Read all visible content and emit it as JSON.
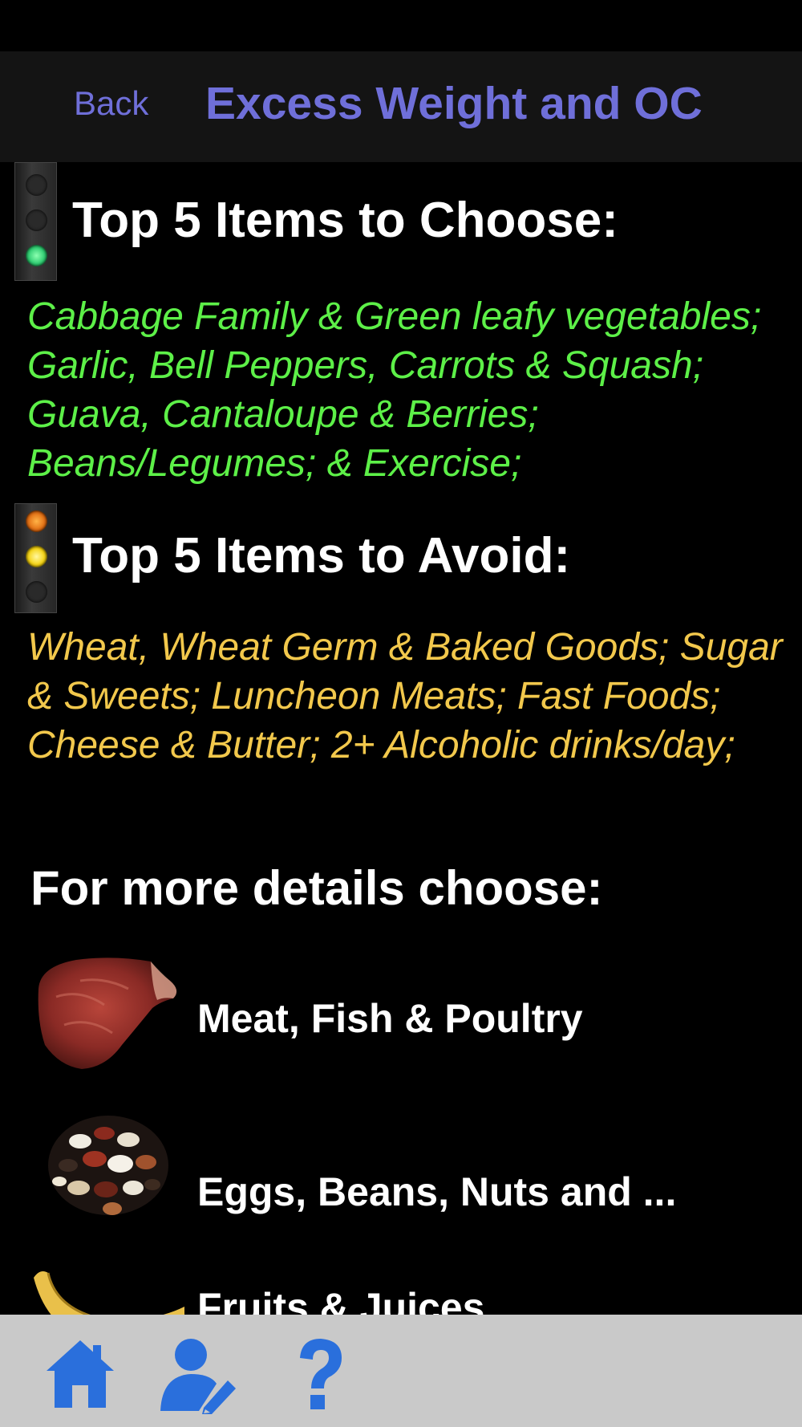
{
  "nav": {
    "back_label": "Back",
    "title": "Excess Weight and OC",
    "accent_color": "#6f6fd9"
  },
  "choose": {
    "heading": "Top 5 Items to Choose:",
    "text": "Cabbage Family & Green leafy vegetables; Garlic, Bell Peppers, Carrots & Squash; Guava, Cantaloupe & Berries; Beans/Legumes; & Exercise;",
    "icon": "traffic-light-green-icon",
    "color": "#5df048"
  },
  "avoid": {
    "heading": "Top 5 Items to Avoid:",
    "text": "Wheat, Wheat Germ & Baked Goods; Sugar & Sweets; Luncheon Meats; Fast Foods; Cheese & Butter; 2+ Alcoholic drinks/day;",
    "icon": "traffic-light-yellow-icon",
    "color": "#f2c84c"
  },
  "details": {
    "heading": "For more details choose:"
  },
  "categories": [
    {
      "label": "Meat, Fish & Poultry",
      "icon": "steak-icon"
    },
    {
      "label": "Eggs, Beans, Nuts and ...",
      "icon": "beans-icon"
    },
    {
      "label": "Fruits & Juices",
      "icon": "banana-icon"
    }
  ],
  "tabbar": {
    "items": [
      {
        "icon": "home-icon"
      },
      {
        "icon": "user-edit-icon"
      },
      {
        "icon": "help-icon"
      }
    ],
    "icon_color": "#2a6fdc"
  }
}
